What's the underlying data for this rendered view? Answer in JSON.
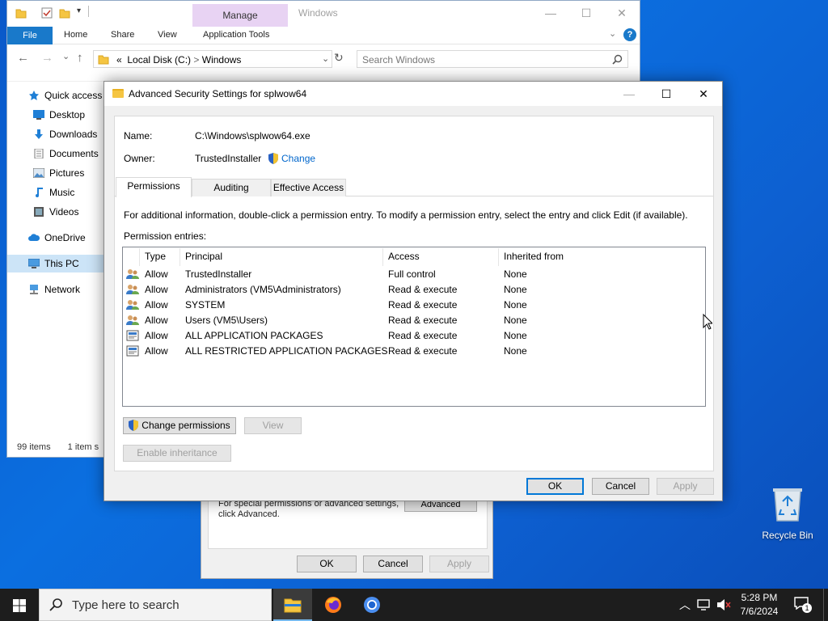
{
  "explorer": {
    "title": "Windows",
    "manage_tab": "Manage",
    "ribbon_tabs": [
      "File",
      "Home",
      "Share",
      "View",
      "Application Tools"
    ],
    "address": {
      "prefix": "«",
      "path1": "Local Disk (C:)",
      "separator": ">",
      "path2": "Windows"
    },
    "search_placeholder": "Search Windows",
    "nav": [
      {
        "label": "Quick access",
        "icon": "star-icon"
      },
      {
        "label": "Desktop",
        "icon": "desktop-icon"
      },
      {
        "label": "Downloads",
        "icon": "download-icon"
      },
      {
        "label": "Documents",
        "icon": "documents-icon"
      },
      {
        "label": "Pictures",
        "icon": "pictures-icon"
      },
      {
        "label": "Music",
        "icon": "music-icon"
      },
      {
        "label": "Videos",
        "icon": "videos-icon"
      },
      {
        "label": "OneDrive",
        "icon": "onedrive-icon"
      },
      {
        "label": "This PC",
        "icon": "pc-icon"
      },
      {
        "label": "Network",
        "icon": "network-icon"
      }
    ],
    "status_count": "99 items",
    "status_selected": "1 item s"
  },
  "props_dialog": {
    "text_line1": "For special permissions or advanced settings,",
    "text_line2": "click Advanced.",
    "advanced_label": "Advanced",
    "ok_label": "OK",
    "cancel_label": "Cancel",
    "apply_label": "Apply"
  },
  "adv": {
    "title": "Advanced Security Settings for splwow64",
    "name_label": "Name:",
    "name_value": "C:\\Windows\\splwow64.exe",
    "owner_label": "Owner:",
    "owner_value": "TrustedInstaller",
    "change_label": "Change",
    "tabs": [
      "Permissions",
      "Auditing",
      "Effective Access"
    ],
    "info_text": "For additional information, double-click a permission entry. To modify a permission entry, select the entry and click Edit (if available).",
    "entries_label": "Permission entries:",
    "columns": [
      "Type",
      "Principal",
      "Access",
      "Inherited from"
    ],
    "rows": [
      {
        "type": "Allow",
        "principal": "TrustedInstaller",
        "access": "Full control",
        "inherited": "None",
        "icon": "users-icon"
      },
      {
        "type": "Allow",
        "principal": "Administrators (VM5\\Administrators)",
        "access": "Read & execute",
        "inherited": "None",
        "icon": "users-icon"
      },
      {
        "type": "Allow",
        "principal": "SYSTEM",
        "access": "Read & execute",
        "inherited": "None",
        "icon": "users-icon"
      },
      {
        "type": "Allow",
        "principal": "Users (VM5\\Users)",
        "access": "Read & execute",
        "inherited": "None",
        "icon": "users-icon"
      },
      {
        "type": "Allow",
        "principal": "ALL APPLICATION PACKAGES",
        "access": "Read & execute",
        "inherited": "None",
        "icon": "package-icon"
      },
      {
        "type": "Allow",
        "principal": "ALL RESTRICTED APPLICATION PACKAGES",
        "access": "Read & execute",
        "inherited": "None",
        "icon": "package-icon"
      }
    ],
    "change_permissions_label": "Change permissions",
    "view_label": "View",
    "enable_inheritance_label": "Enable inheritance",
    "ok_label": "OK",
    "cancel_label": "Cancel",
    "apply_label": "Apply"
  },
  "desktop": {
    "recycle_bin": "Recycle Bin"
  },
  "taskbar": {
    "search_placeholder": "Type here to search",
    "time": "5:28 PM",
    "date": "7/6/2024",
    "notification_count": "1"
  },
  "colors": {
    "accent": "#0078d7",
    "ribbon_file": "#1979ca",
    "manage_tab": "#e8d3f3",
    "desktop": "#0b6fe0",
    "taskbar": "#1d1d1d"
  }
}
